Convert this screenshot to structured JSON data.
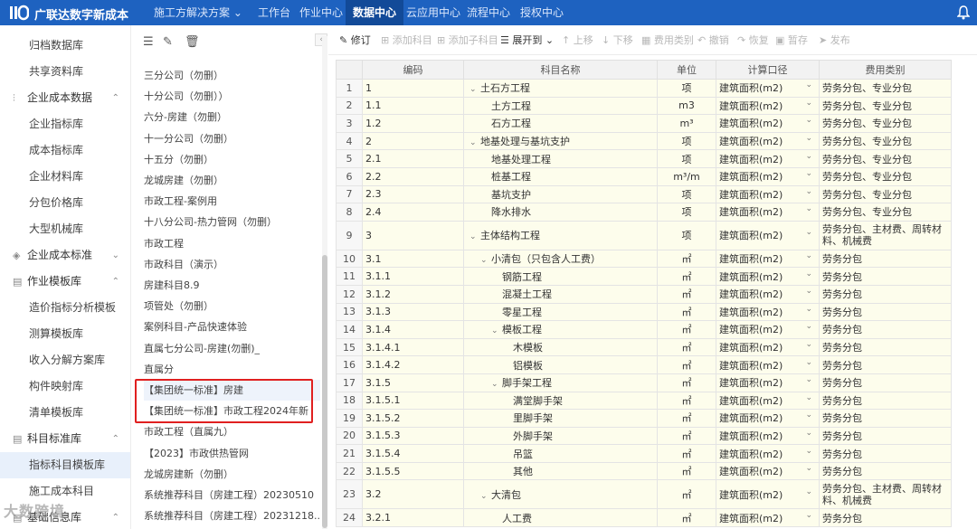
{
  "app": {
    "title": "广联达数字新成本"
  },
  "nav": {
    "solutions": "施工方解决方案 ⌄",
    "items": [
      "工作台",
      "作业中心",
      "数据中心",
      "云应用中心",
      "流程中心",
      "授权中心"
    ],
    "active": "数据中心"
  },
  "sidebar": {
    "items": [
      {
        "label": "归档数据库",
        "kind": "sub"
      },
      {
        "label": "共享资料库",
        "kind": "sub"
      },
      {
        "label": "企业成本数据",
        "kind": "group"
      },
      {
        "label": "企业指标库",
        "kind": "sub"
      },
      {
        "label": "成本指标库",
        "kind": "sub"
      },
      {
        "label": "企业材料库",
        "kind": "sub"
      },
      {
        "label": "分包价格库",
        "kind": "sub"
      },
      {
        "label": "大型机械库",
        "kind": "sub"
      },
      {
        "label": "企业成本标准",
        "kind": "group"
      },
      {
        "label": "作业模板库",
        "kind": "group"
      },
      {
        "label": "造价指标分析模板",
        "kind": "sub"
      },
      {
        "label": "测算模板库",
        "kind": "sub"
      },
      {
        "label": "收入分解方案库",
        "kind": "sub"
      },
      {
        "label": "构件映射库",
        "kind": "sub"
      },
      {
        "label": "清单模板库",
        "kind": "sub"
      },
      {
        "label": "科目标准库",
        "kind": "group"
      },
      {
        "label": "指标科目模板库",
        "kind": "sub"
      },
      {
        "label": "施工成本科目",
        "kind": "sub"
      },
      {
        "label": "基础信息库",
        "kind": "group"
      }
    ],
    "watermark": "大数跨境"
  },
  "list": {
    "items": [
      "三分公司（勿删）",
      "十分公司（勿删））",
      "六分-房建（勿删）",
      "十一分公司（勿删）",
      "十五分（勿删）",
      "龙城房建（勿删）",
      "市政工程-案例用",
      "十八分公司-热力管网（勿删）",
      "市政工程",
      "市政科目（演示）",
      "房建科目8.9",
      "项管处（勿删）",
      "案例科目-产品快速体验",
      "直属七分公司-房建(勿删)_",
      "直属分",
      "【集团统一标准】房建",
      "【集团统一标准】市政工程2024年新",
      "市政工程（直属九）",
      "【2023】市政供热管网",
      "龙城房建新（勿删）",
      "系统推荐科目（房建工程）20230510",
      "系统推荐科目（房建工程）20231218..."
    ]
  },
  "toolbar": {
    "items": [
      "修订",
      "添加科目",
      "添加子科目",
      "展开到 ⌄",
      "上移",
      "下移",
      "费用类别",
      "撤销",
      "恢复",
      "暂存",
      "发布"
    ]
  },
  "table": {
    "headers": [
      "",
      "编码",
      "科目名称",
      "单位",
      "计算口径",
      "费用类别"
    ],
    "rows": [
      {
        "n": "1",
        "code": "1",
        "name": "土石方工程",
        "lvl": 0,
        "tw": "⌄",
        "unit": "项",
        "basis": "建筑面积(m2)",
        "cat": "劳务分包、专业分包"
      },
      {
        "n": "2",
        "code": "1.1",
        "name": "土方工程",
        "lvl": 1,
        "tw": "",
        "unit": "m3",
        "basis": "建筑面积(m2)",
        "cat": "劳务分包、专业分包"
      },
      {
        "n": "3",
        "code": "1.2",
        "name": "石方工程",
        "lvl": 1,
        "tw": "",
        "unit": "m³",
        "basis": "建筑面积(m2)",
        "cat": "劳务分包、专业分包"
      },
      {
        "n": "4",
        "code": "2",
        "name": "地基处理与基坑支护",
        "lvl": 0,
        "tw": "⌄",
        "unit": "项",
        "basis": "建筑面积(m2)",
        "cat": "劳务分包、专业分包"
      },
      {
        "n": "5",
        "code": "2.1",
        "name": "地基处理工程",
        "lvl": 1,
        "tw": "",
        "unit": "项",
        "basis": "建筑面积(m2)",
        "cat": "劳务分包、专业分包"
      },
      {
        "n": "6",
        "code": "2.2",
        "name": "桩基工程",
        "lvl": 1,
        "tw": "",
        "unit": "m³/m",
        "basis": "建筑面积(m2)",
        "cat": "劳务分包、专业分包"
      },
      {
        "n": "7",
        "code": "2.3",
        "name": "基坑支护",
        "lvl": 1,
        "tw": "",
        "unit": "项",
        "basis": "建筑面积(m2)",
        "cat": "劳务分包、专业分包"
      },
      {
        "n": "8",
        "code": "2.4",
        "name": "降水排水",
        "lvl": 1,
        "tw": "",
        "unit": "项",
        "basis": "建筑面积(m2)",
        "cat": "劳务分包、专业分包"
      },
      {
        "n": "9",
        "code": "3",
        "name": "主体结构工程",
        "lvl": 0,
        "tw": "⌄",
        "unit": "项",
        "basis": "建筑面积(m2)",
        "cat": "劳务分包、主材费、周转材料、机械费",
        "tall": true
      },
      {
        "n": "10",
        "code": "3.1",
        "name": "小清包（只包含人工费）",
        "lvl": 1,
        "tw": "⌄",
        "unit": "㎡",
        "basis": "建筑面积(m2)",
        "cat": "劳务分包"
      },
      {
        "n": "11",
        "code": "3.1.1",
        "name": "钢筋工程",
        "lvl": 2,
        "tw": "",
        "unit": "㎡",
        "basis": "建筑面积(m2)",
        "cat": "劳务分包"
      },
      {
        "n": "12",
        "code": "3.1.2",
        "name": "混凝土工程",
        "lvl": 2,
        "tw": "",
        "unit": "㎡",
        "basis": "建筑面积(m2)",
        "cat": "劳务分包"
      },
      {
        "n": "13",
        "code": "3.1.3",
        "name": "零星工程",
        "lvl": 2,
        "tw": "",
        "unit": "㎡",
        "basis": "建筑面积(m2)",
        "cat": "劳务分包"
      },
      {
        "n": "14",
        "code": "3.1.4",
        "name": "模板工程",
        "lvl": 2,
        "tw": "⌄",
        "unit": "㎡",
        "basis": "建筑面积(m2)",
        "cat": "劳务分包"
      },
      {
        "n": "15",
        "code": "3.1.4.1",
        "name": "木模板",
        "lvl": 3,
        "tw": "",
        "unit": "㎡",
        "basis": "建筑面积(m2)",
        "cat": "劳务分包"
      },
      {
        "n": "16",
        "code": "3.1.4.2",
        "name": "铝模板",
        "lvl": 3,
        "tw": "",
        "unit": "㎡",
        "basis": "建筑面积(m2)",
        "cat": "劳务分包"
      },
      {
        "n": "17",
        "code": "3.1.5",
        "name": "脚手架工程",
        "lvl": 2,
        "tw": "⌄",
        "unit": "㎡",
        "basis": "建筑面积(m2)",
        "cat": "劳务分包"
      },
      {
        "n": "18",
        "code": "3.1.5.1",
        "name": "满堂脚手架",
        "lvl": 3,
        "tw": "",
        "unit": "㎡",
        "basis": "建筑面积(m2)",
        "cat": "劳务分包"
      },
      {
        "n": "19",
        "code": "3.1.5.2",
        "name": "里脚手架",
        "lvl": 3,
        "tw": "",
        "unit": "㎡",
        "basis": "建筑面积(m2)",
        "cat": "劳务分包"
      },
      {
        "n": "20",
        "code": "3.1.5.3",
        "name": "外脚手架",
        "lvl": 3,
        "tw": "",
        "unit": "㎡",
        "basis": "建筑面积(m2)",
        "cat": "劳务分包"
      },
      {
        "n": "21",
        "code": "3.1.5.4",
        "name": "吊篮",
        "lvl": 3,
        "tw": "",
        "unit": "㎡",
        "basis": "建筑面积(m2)",
        "cat": "劳务分包"
      },
      {
        "n": "22",
        "code": "3.1.5.5",
        "name": "其他",
        "lvl": 3,
        "tw": "",
        "unit": "㎡",
        "basis": "建筑面积(m2)",
        "cat": "劳务分包"
      },
      {
        "n": "23",
        "code": "3.2",
        "name": "大清包",
        "lvl": 1,
        "tw": "⌄",
        "unit": "㎡",
        "basis": "建筑面积(m2)",
        "cat": "劳务分包、主材费、周转材料、机械费",
        "tall": true
      },
      {
        "n": "24",
        "code": "3.2.1",
        "name": "人工费",
        "lvl": 2,
        "tw": "",
        "unit": "㎡",
        "basis": "建筑面积(m2)",
        "cat": "劳务分包"
      }
    ]
  }
}
